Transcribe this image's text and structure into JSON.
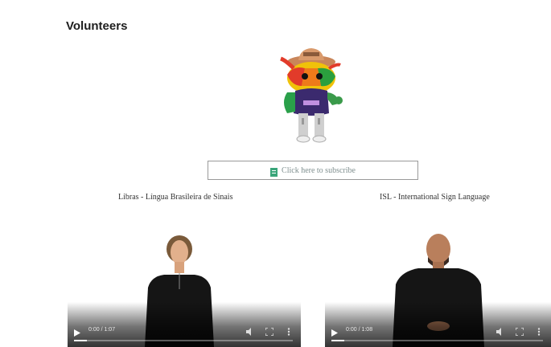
{
  "page": {
    "title": "Volunteers"
  },
  "mascot": {
    "icon": "mascot-illustration"
  },
  "subscribe": {
    "icon": "subtitles-icon",
    "label": "Click here to subscribe",
    "accent": "#3aa57a"
  },
  "languages": {
    "left": "Libras - Língua Brasileira de Sinais",
    "right": "ISL - International Sign Language"
  },
  "videos": [
    {
      "time": "0:00 / 1:07",
      "progress": 0.06,
      "controls": [
        "play-icon",
        "volume-icon",
        "fullscreen-icon",
        "more-icon"
      ]
    },
    {
      "time": "0:00 / 1:08",
      "progress": 0.06,
      "controls": [
        "play-icon",
        "volume-icon",
        "fullscreen-icon",
        "more-icon"
      ]
    }
  ]
}
